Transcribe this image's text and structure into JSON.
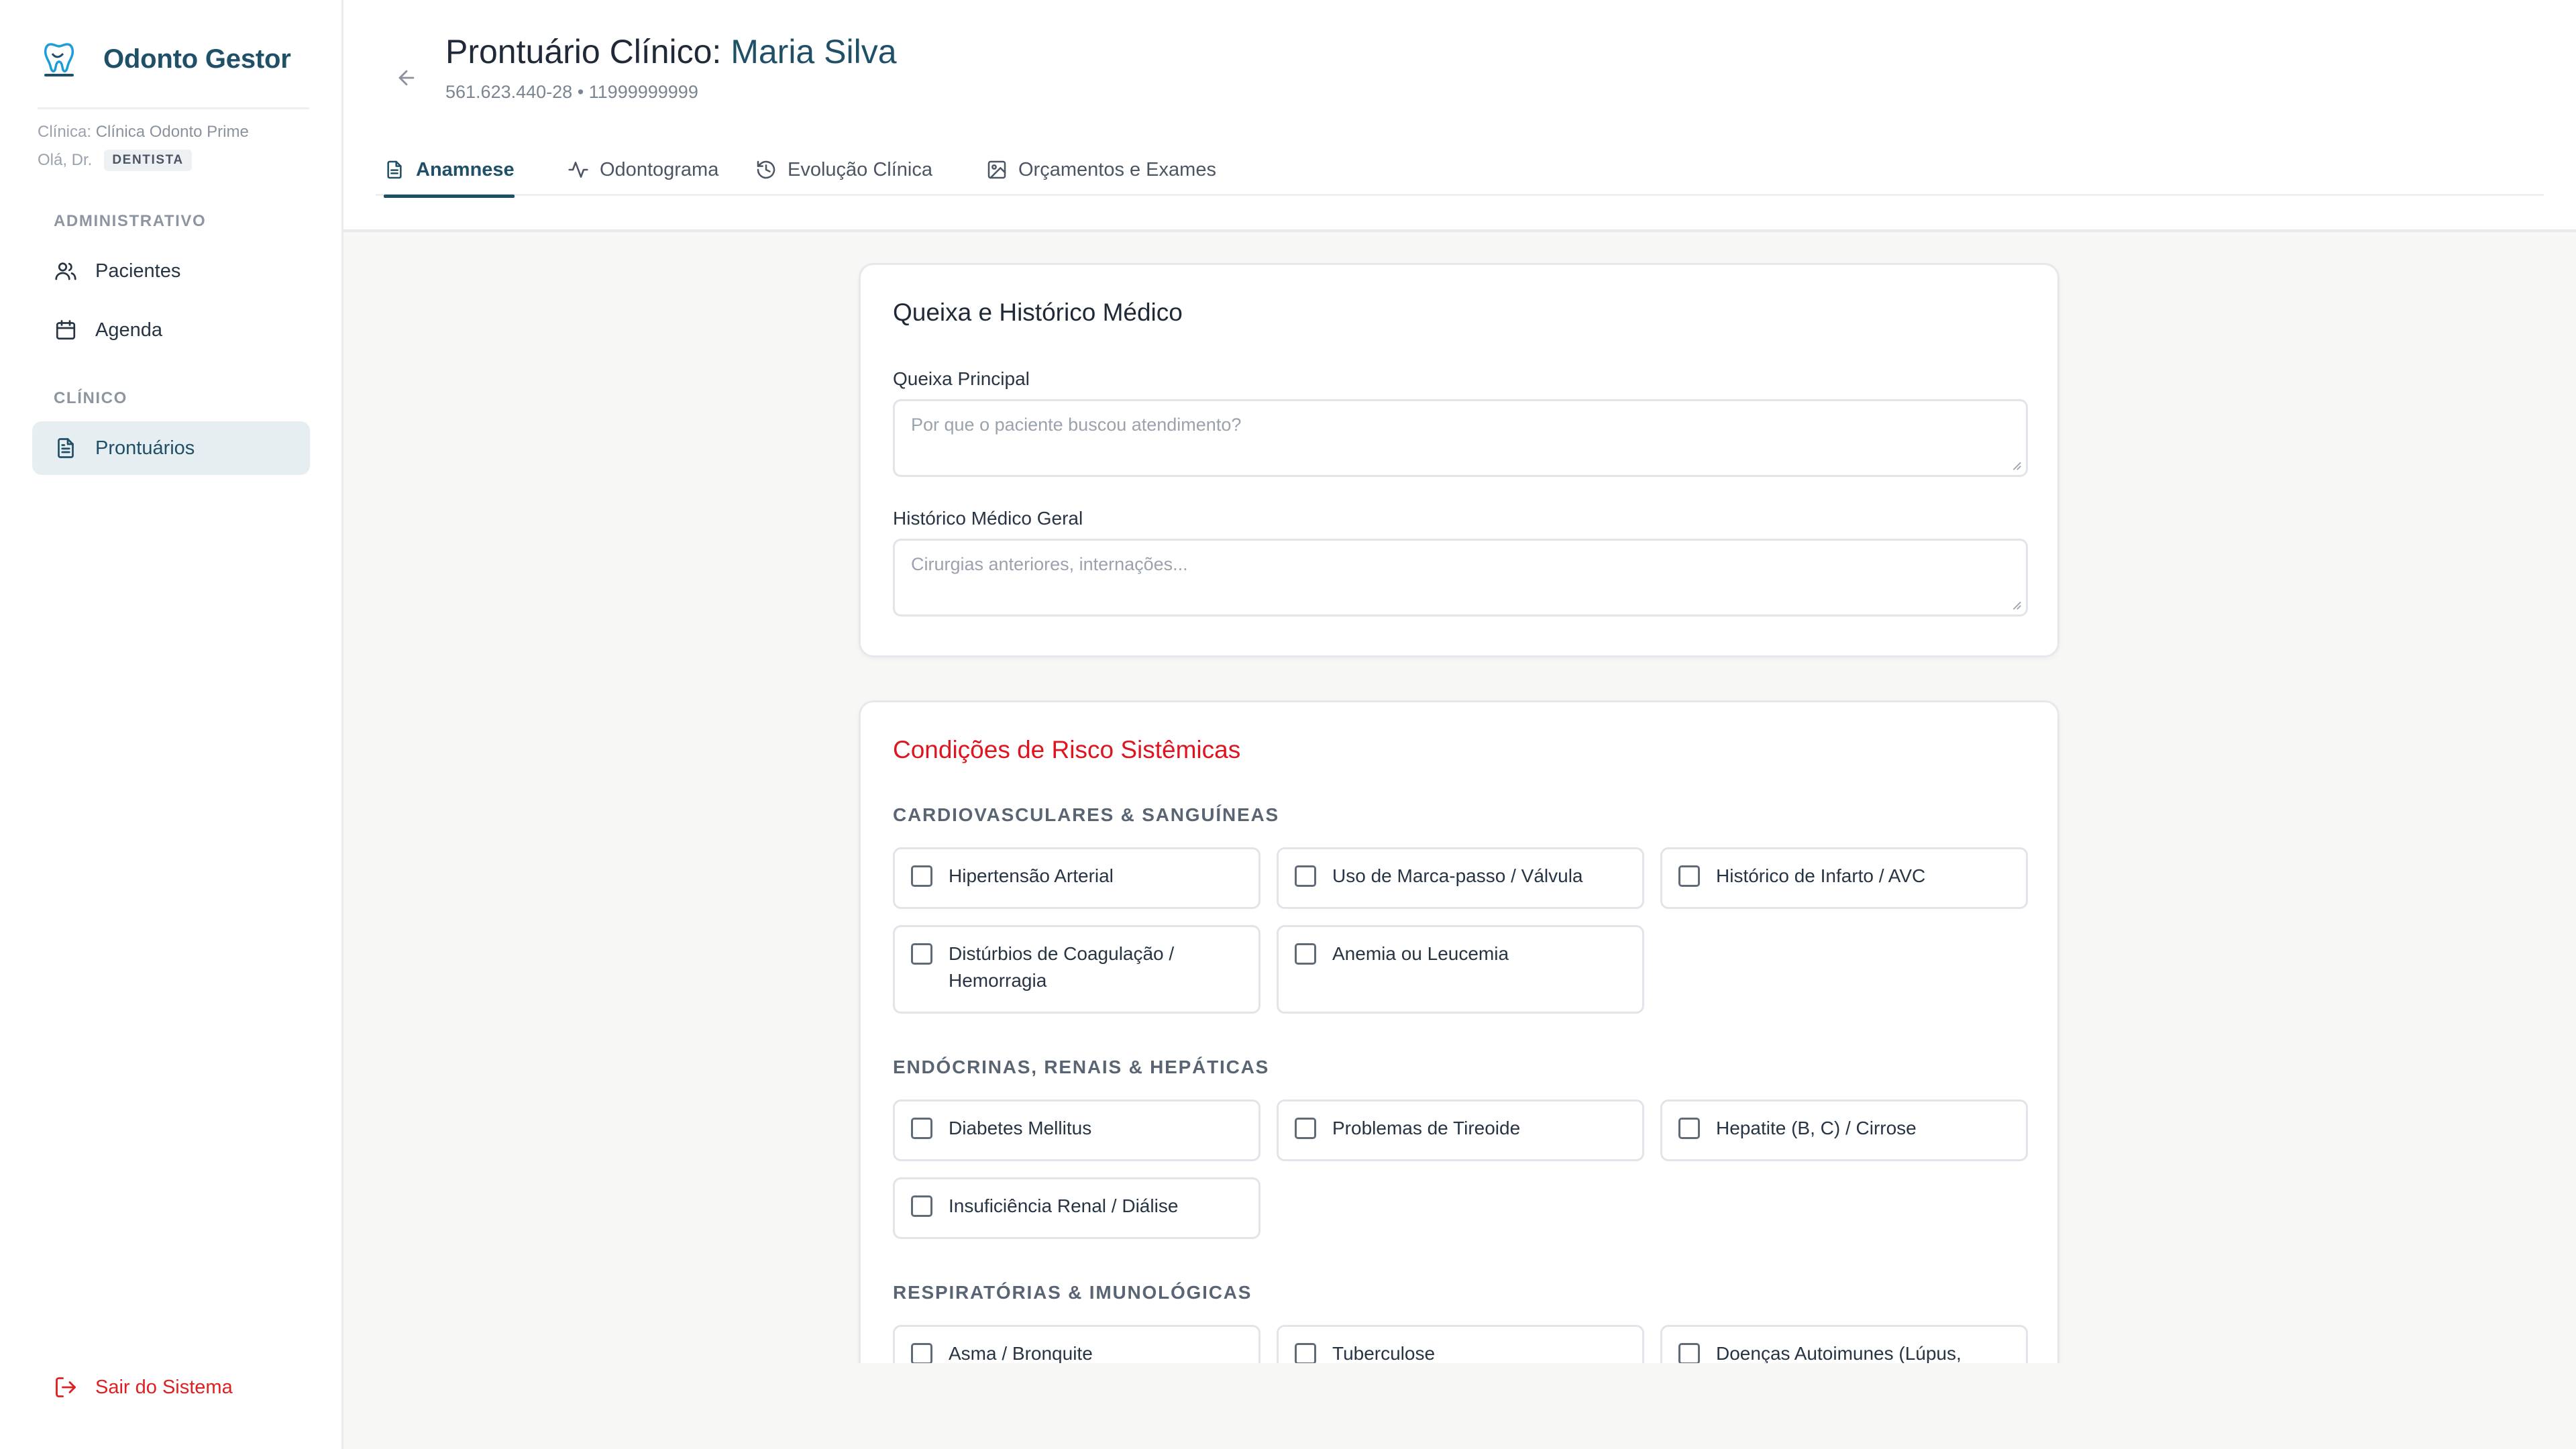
{
  "app": {
    "name": "Odonto Gestor",
    "logo_icon": "tooth-logo-icon"
  },
  "sidebar": {
    "clinic_label": "Clínica:",
    "clinic_name": "Clínica Odonto Prime",
    "greeting": "Olá, Dr.",
    "role": "DENTISTA",
    "sections": [
      {
        "title": "ADMINISTRATIVO",
        "items": [
          {
            "label": "Pacientes",
            "icon": "users-icon"
          },
          {
            "label": "Agenda",
            "icon": "calendar-icon"
          }
        ]
      },
      {
        "title": "CLÍNICO",
        "items": [
          {
            "label": "Prontuários",
            "icon": "file-text-icon",
            "active": true
          }
        ]
      }
    ],
    "logout_label": "Sair do Sistema"
  },
  "header": {
    "title_prefix": "Prontuário Clínico:",
    "patient_name": "Maria Silva",
    "patient_cpf": "561.623.440-28",
    "separator": "•",
    "patient_phone": "11999999999",
    "tabs": [
      {
        "label": "Anamnese",
        "icon": "file-text-icon",
        "active": true
      },
      {
        "label": "Odontograma",
        "icon": "activity-icon"
      },
      {
        "label": "Evolução Clínica",
        "icon": "history-icon"
      },
      {
        "label": "Orçamentos e Exames",
        "icon": "image-icon"
      }
    ]
  },
  "complaint_card": {
    "title": "Queixa e Histórico Médico",
    "fields": [
      {
        "label": "Queixa Principal",
        "placeholder": "Por que o paciente buscou atendimento?",
        "value": ""
      },
      {
        "label": "Histórico Médico Geral",
        "placeholder": "Cirurgias anteriores, internações...",
        "value": ""
      }
    ]
  },
  "risk_card": {
    "title": "Condições de Risco Sistêmicas",
    "accent_color": "#e0141e",
    "groups": [
      {
        "title": "CARDIOVASCULARES & SANGUÍNEAS",
        "options": [
          {
            "label": "Hipertensão Arterial",
            "checked": false
          },
          {
            "label": "Uso de Marca-passo / Válvula",
            "checked": false
          },
          {
            "label": "Histórico de Infarto / AVC",
            "checked": false
          },
          {
            "label": "Distúrbios de Coagulação / Hemorragia",
            "checked": false
          },
          {
            "label": "Anemia ou Leucemia",
            "checked": false
          }
        ]
      },
      {
        "title": "ENDÓCRINAS, RENAIS & HEPÁTICAS",
        "options": [
          {
            "label": "Diabetes Mellitus",
            "checked": false
          },
          {
            "label": "Problemas de Tireoide",
            "checked": false
          },
          {
            "label": "Hepatite (B, C) / Cirrose",
            "checked": false
          },
          {
            "label": "Insuficiência Renal / Diálise",
            "checked": false
          }
        ]
      },
      {
        "title": "RESPIRATÓRIAS & IMUNOLÓGICAS",
        "options": [
          {
            "label": "Asma / Bronquite",
            "checked": false
          },
          {
            "label": "Tuberculose",
            "checked": false
          },
          {
            "label": "Doenças Autoimunes (Lúpus,",
            "checked": false
          }
        ]
      }
    ]
  },
  "colors": {
    "brand": "#1f5068",
    "danger": "#e0141e",
    "active_nav_bg": "#e6eef2"
  }
}
